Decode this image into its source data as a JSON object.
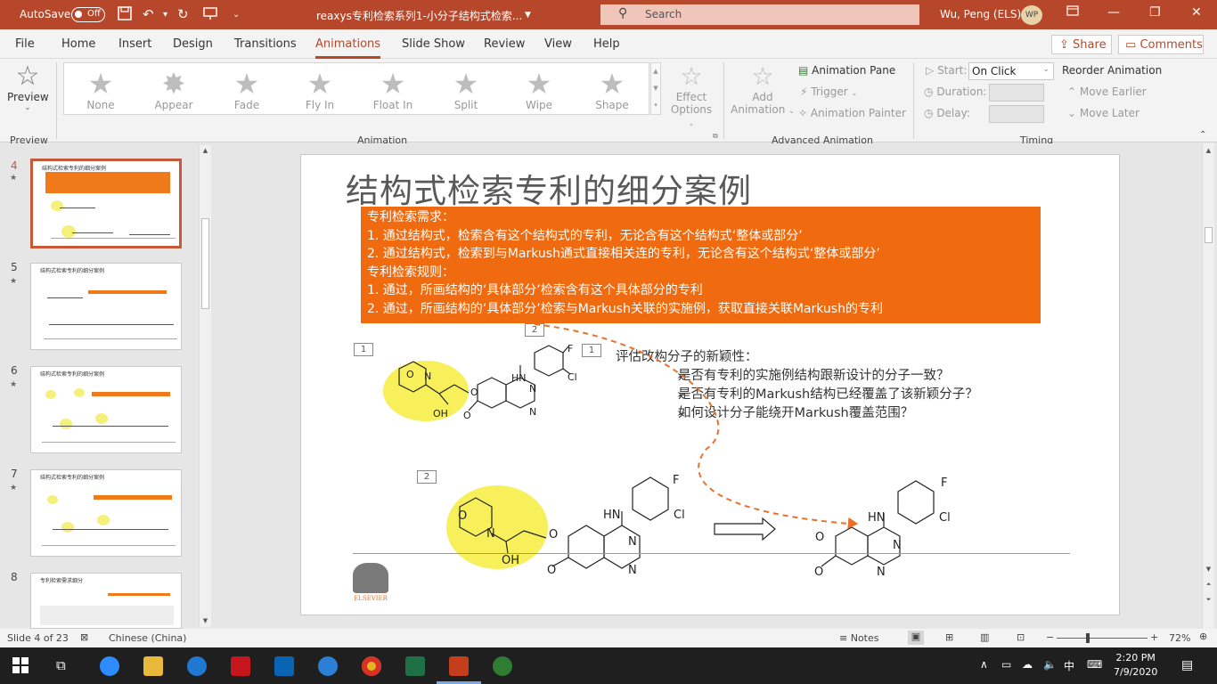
{
  "titlebar": {
    "autosave_label": "AutoSave",
    "autosave_state": "Off",
    "doc_title": "reaxys专利检索系列1-小分子结构式检索...",
    "search_placeholder": "Search",
    "user_name": "Wu, Peng (ELS)",
    "user_initials": "WP"
  },
  "tabs": [
    "File",
    "Home",
    "Insert",
    "Design",
    "Transitions",
    "Animations",
    "Slide Show",
    "Review",
    "View",
    "Help"
  ],
  "active_tab": "Animations",
  "share_label": "Share",
  "comments_label": "Comments",
  "ribbon": {
    "preview_label": "Preview",
    "preview_group": "Preview",
    "animations": [
      "None",
      "Appear",
      "Fade",
      "Fly In",
      "Float In",
      "Split",
      "Wipe",
      "Shape"
    ],
    "effect_options_1": "Effect",
    "effect_options_2": "Options",
    "animation_group": "Animation",
    "add_animation_1": "Add",
    "add_animation_2": "Animation",
    "animation_pane": "Animation Pane",
    "trigger": "Trigger",
    "animation_painter": "Animation Painter",
    "advanced_group": "Advanced Animation",
    "start_label": "Start:",
    "start_value": "On Click",
    "duration_label": "Duration:",
    "delay_label": "Delay:",
    "reorder_label": "Reorder Animation",
    "move_earlier": "Move Earlier",
    "move_later": "Move Later",
    "timing_group": "Timing"
  },
  "thumbnails": [
    {
      "num": "4",
      "title": "结构式检索专利的细分案例",
      "selected": true
    },
    {
      "num": "5",
      "title": "结构式检索专利的细分案例",
      "selected": false
    },
    {
      "num": "6",
      "title": "结构式检索专利的细分案例",
      "selected": false
    },
    {
      "num": "7",
      "title": "结构式检索专利的细分案例",
      "selected": false
    },
    {
      "num": "8",
      "title": "专利检索需求细分",
      "selected": false
    }
  ],
  "slide": {
    "title": "结构式检索专利的细分案例",
    "box_lines": [
      "专利检索需求：",
      "1. 通过结构式，检索含有这个结构式的专利，无论含有这个结构式‘整体或部分’",
      "2. 通过结构式，检索到与Markush通式直接相关连的专利，无论含有这个结构式‘整体或部分’",
      "专利检索规则：",
      "1. 通过，所画结构的‘具体部分’检索含有这个具体部分的专利",
      "2. 通过，所画结构的‘具体部分’检索与Markush关联的实施例，获取直接关联Markush的专利"
    ],
    "eval_title": "评估改构分子的新颖性：",
    "eval_items": [
      "是否有专利的实施例结构跟新设计的分子一致？",
      "是否有专利的Markush结构已经覆盖了该新颖分子？",
      "如何设计分子能绕开Markush覆盖范围？"
    ],
    "label_1a": "1",
    "label_1b": "1",
    "label_2a": "2",
    "label_2b": "2",
    "atoms": {
      "F": "F",
      "Cl": "Cl",
      "HN": "HN",
      "OH": "OH",
      "O": "O",
      "N": "N"
    },
    "logo_text": "ELSEVIER"
  },
  "status": {
    "slide_info": "Slide 4 of 23",
    "language": "Chinese (China)",
    "notes": "Notes",
    "zoom": "72%"
  },
  "clock": {
    "time": "2:20 PM",
    "date": "7/9/2020"
  },
  "tray": {
    "ime": "中"
  }
}
